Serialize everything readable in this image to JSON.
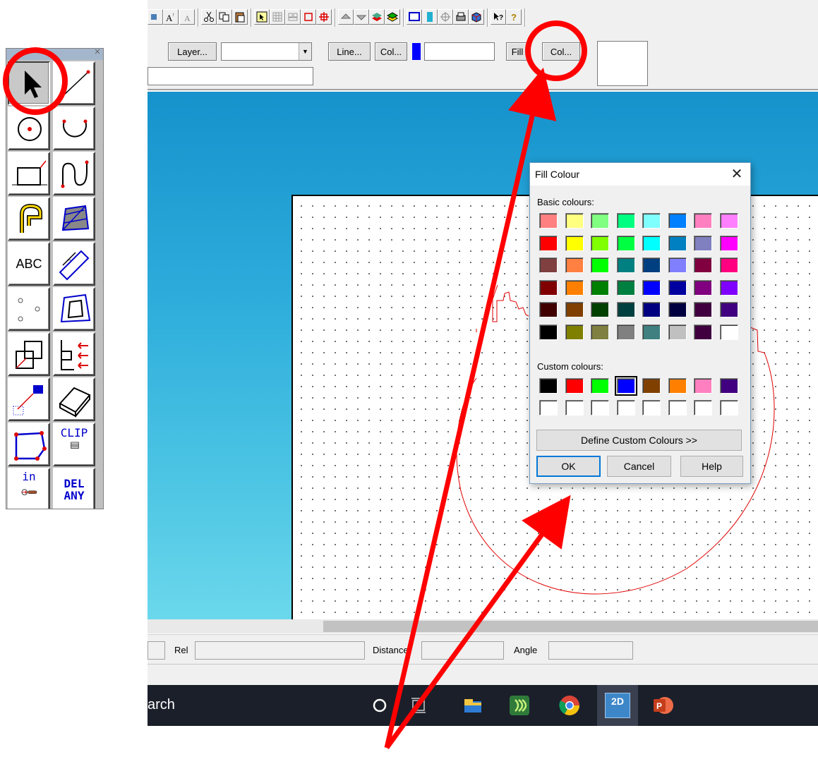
{
  "palette": {
    "tools": [
      {
        "name": "select-arrow-tool",
        "icon": "pointer-arrow-icon"
      },
      {
        "name": "line-tool",
        "icon": "line-icon"
      },
      {
        "name": "circle-tool",
        "icon": "circle-center-icon"
      },
      {
        "name": "arc-tool",
        "icon": "arc-icon"
      },
      {
        "name": "rectangle-tool",
        "icon": "rectangle-icon"
      },
      {
        "name": "curve-tool",
        "icon": "curve-icon"
      },
      {
        "name": "offset-tool",
        "icon": "offset-icon"
      },
      {
        "name": "hatch-tool",
        "icon": "hatch-icon"
      },
      {
        "name": "text-tool",
        "icon": "abc-text-icon",
        "label": "ABC"
      },
      {
        "name": "dimension-tool",
        "icon": "dimension-icon"
      },
      {
        "name": "points-tool",
        "icon": "points-icon"
      },
      {
        "name": "fill-region-tool",
        "icon": "fill-region-icon"
      },
      {
        "name": "group-tool",
        "icon": "group-boxes-icon"
      },
      {
        "name": "align-tool",
        "icon": "align-icon"
      },
      {
        "name": "pattern-tool",
        "icon": "pattern-icon"
      },
      {
        "name": "extrude-tool",
        "icon": "3d-block-icon"
      },
      {
        "name": "polygon-tool",
        "icon": "polygon-icon"
      },
      {
        "name": "clip-tool",
        "icon": "clip-icon",
        "label": "CLIP"
      },
      {
        "name": "insert-tool",
        "icon": "insert-icon",
        "label": "in"
      },
      {
        "name": "delete-any-tool",
        "icon": "delete-icon",
        "label": "DEL\nANY"
      }
    ]
  },
  "toolbar": {
    "layer_button": "Layer...",
    "layer_value": "",
    "line_button": "Line...",
    "line_colour_button": "Col...",
    "line_colour_swatch": "#0000ff",
    "fill_button": "Fill",
    "fill_colour_button": "Col..."
  },
  "status": {
    "rel_label": "Rel",
    "distance_label": "Distance",
    "angle_label": "Angle"
  },
  "taskbar": {
    "search_text": "arch",
    "apps": [
      "cortana-icon",
      "task-view-icon",
      "file-explorer-icon",
      "green-app-icon",
      "chrome-icon",
      "2d-design-icon",
      "powerpoint-icon"
    ],
    "app_badge": "2D"
  },
  "dialog": {
    "title": "Fill Colour",
    "basic_label": "Basic colours:",
    "custom_label": "Custom colours:",
    "basic_colours": [
      [
        "#ff8080",
        "#ffff80",
        "#80ff80",
        "#00ff80",
        "#80ffff",
        "#0080ff",
        "#ff80c0",
        "#ff80ff"
      ],
      [
        "#ff0000",
        "#ffff00",
        "#80ff00",
        "#00ff40",
        "#00ffff",
        "#0080c0",
        "#8080c0",
        "#ff00ff"
      ],
      [
        "#804040",
        "#ff8040",
        "#00ff00",
        "#008080",
        "#004080",
        "#8080ff",
        "#800040",
        "#ff0080"
      ],
      [
        "#800000",
        "#ff8000",
        "#008000",
        "#008040",
        "#0000ff",
        "#0000a0",
        "#800080",
        "#8000ff"
      ],
      [
        "#400000",
        "#804000",
        "#004000",
        "#004040",
        "#000080",
        "#000040",
        "#400040",
        "#400080"
      ],
      [
        "#000000",
        "#808000",
        "#808040",
        "#808080",
        "#408080",
        "#c0c0c0",
        "#400040",
        "#ffffff"
      ]
    ],
    "custom_colours": [
      "#000000",
      "#ff0000",
      "#00ff00",
      "#0000ff",
      "#804000",
      "#ff8000",
      "#ff80c0",
      "#400080"
    ],
    "selected_custom_index": 3,
    "define_button": "Define Custom Colours >>",
    "ok_button": "OK",
    "cancel_button": "Cancel",
    "help_button": "Help"
  },
  "annotation_colour": "#ff0000"
}
